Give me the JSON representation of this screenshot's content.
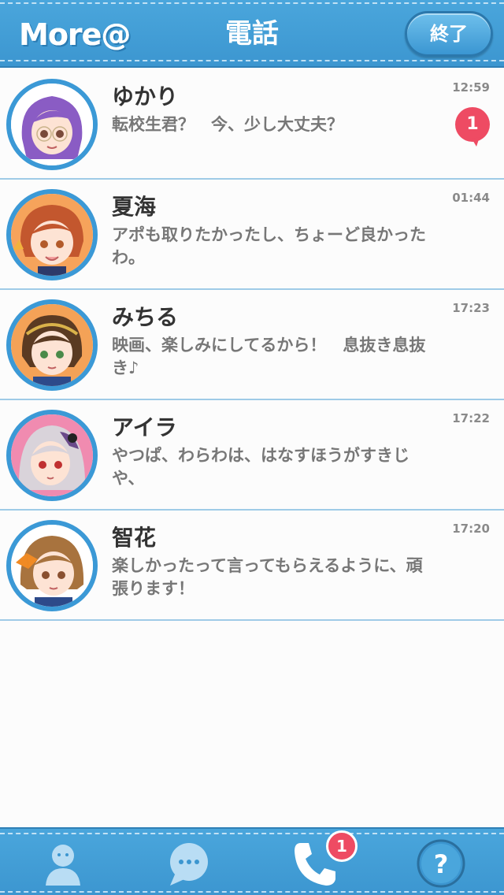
{
  "header": {
    "logo": "More@",
    "title": "電話",
    "end_label": "終了"
  },
  "calls": [
    {
      "name": "ゆかり",
      "message": "転校生君？　今、少し大丈夫？",
      "time": "12:59",
      "unread": "1",
      "hair": "#8a5cc4",
      "bg": "#ffffff"
    },
    {
      "name": "夏海",
      "message": "アポも取りたかったし、ちょーど良かったわ。",
      "time": "01:44",
      "unread": "",
      "hair": "#c3572e",
      "bg": "#f6a35b"
    },
    {
      "name": "みちる",
      "message": "映画、楽しみにしてるから！　息抜き息抜き♪",
      "time": "17:23",
      "unread": "",
      "hair": "#5a3a22",
      "bg": "#f4a257"
    },
    {
      "name": "アイラ",
      "message": "やつぱ、わらわは、はなすほうがすきじや、",
      "time": "17:22",
      "unread": "",
      "hair": "#d9d3da",
      "bg": "#f08bb0"
    },
    {
      "name": "智花",
      "message": "楽しかったって言ってもらえるように、頑張ります！",
      "time": "17:20",
      "unread": "",
      "hair": "#a8733e",
      "bg": "#ffffff"
    }
  ],
  "tabbar": {
    "tabs": [
      {
        "icon": "profile-icon"
      },
      {
        "icon": "chat-icon"
      },
      {
        "icon": "phone-icon",
        "badge": "1"
      },
      {
        "icon": "help-icon"
      }
    ]
  },
  "colors": {
    "accent": "#3c96d0",
    "badge": "#ee4b63",
    "divider": "#9fcbe7"
  }
}
